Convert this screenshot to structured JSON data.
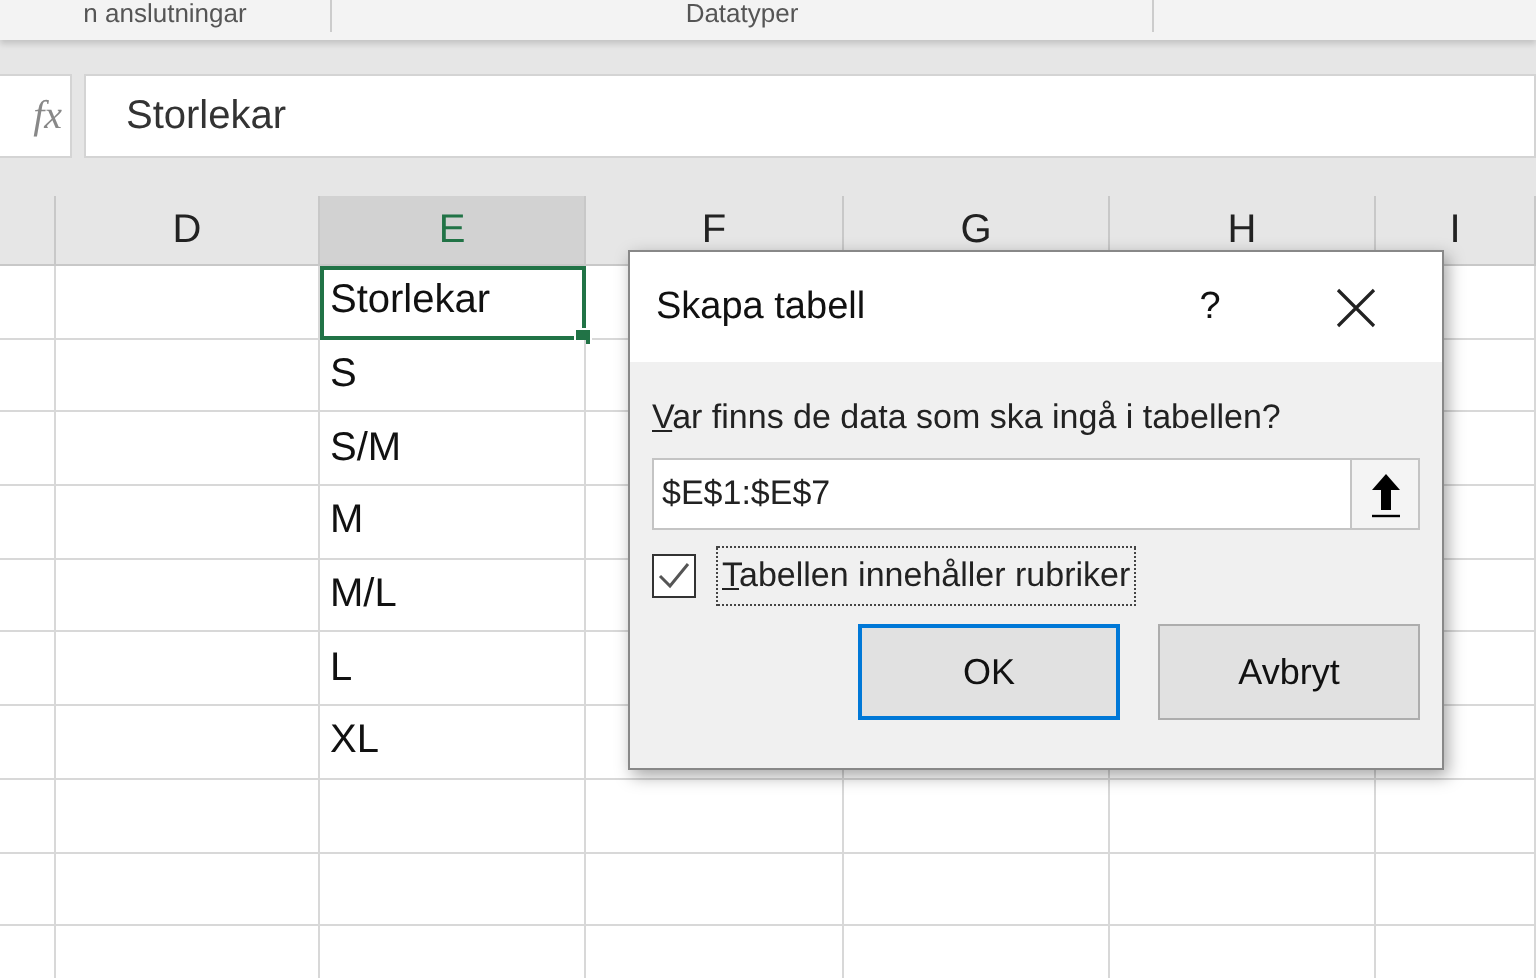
{
  "ribbon": {
    "groups": [
      "n anslutningar",
      "Datatyper"
    ]
  },
  "formula_bar": {
    "function_label": "fx",
    "value": "Storlekar"
  },
  "columns": [
    {
      "label": "D",
      "selected": false
    },
    {
      "label": "E",
      "selected": true
    },
    {
      "label": "F",
      "selected": false
    },
    {
      "label": "G",
      "selected": false
    },
    {
      "label": "H",
      "selected": false
    },
    {
      "label": "I",
      "selected": false
    }
  ],
  "cells": [
    {
      "value": "Storlekar",
      "selected": true
    },
    {
      "value": "S",
      "selected": false
    },
    {
      "value": "S/M",
      "selected": false
    },
    {
      "value": "M",
      "selected": false
    },
    {
      "value": "M/L",
      "selected": false
    },
    {
      "value": "L",
      "selected": false
    },
    {
      "value": "XL",
      "selected": false
    }
  ],
  "dialog": {
    "title": "Skapa tabell",
    "help": "?",
    "prompt": "Var finns de data som ska ingå i tabellen?",
    "range_field": {
      "value": "$E$1:$E$7"
    },
    "header_checkbox": {
      "label": "Tabellen innehåller rubriker",
      "checked": true
    },
    "buttons": [
      {
        "label": "OK",
        "default": true
      },
      {
        "label": "Avbryt",
        "default": false
      }
    ]
  }
}
